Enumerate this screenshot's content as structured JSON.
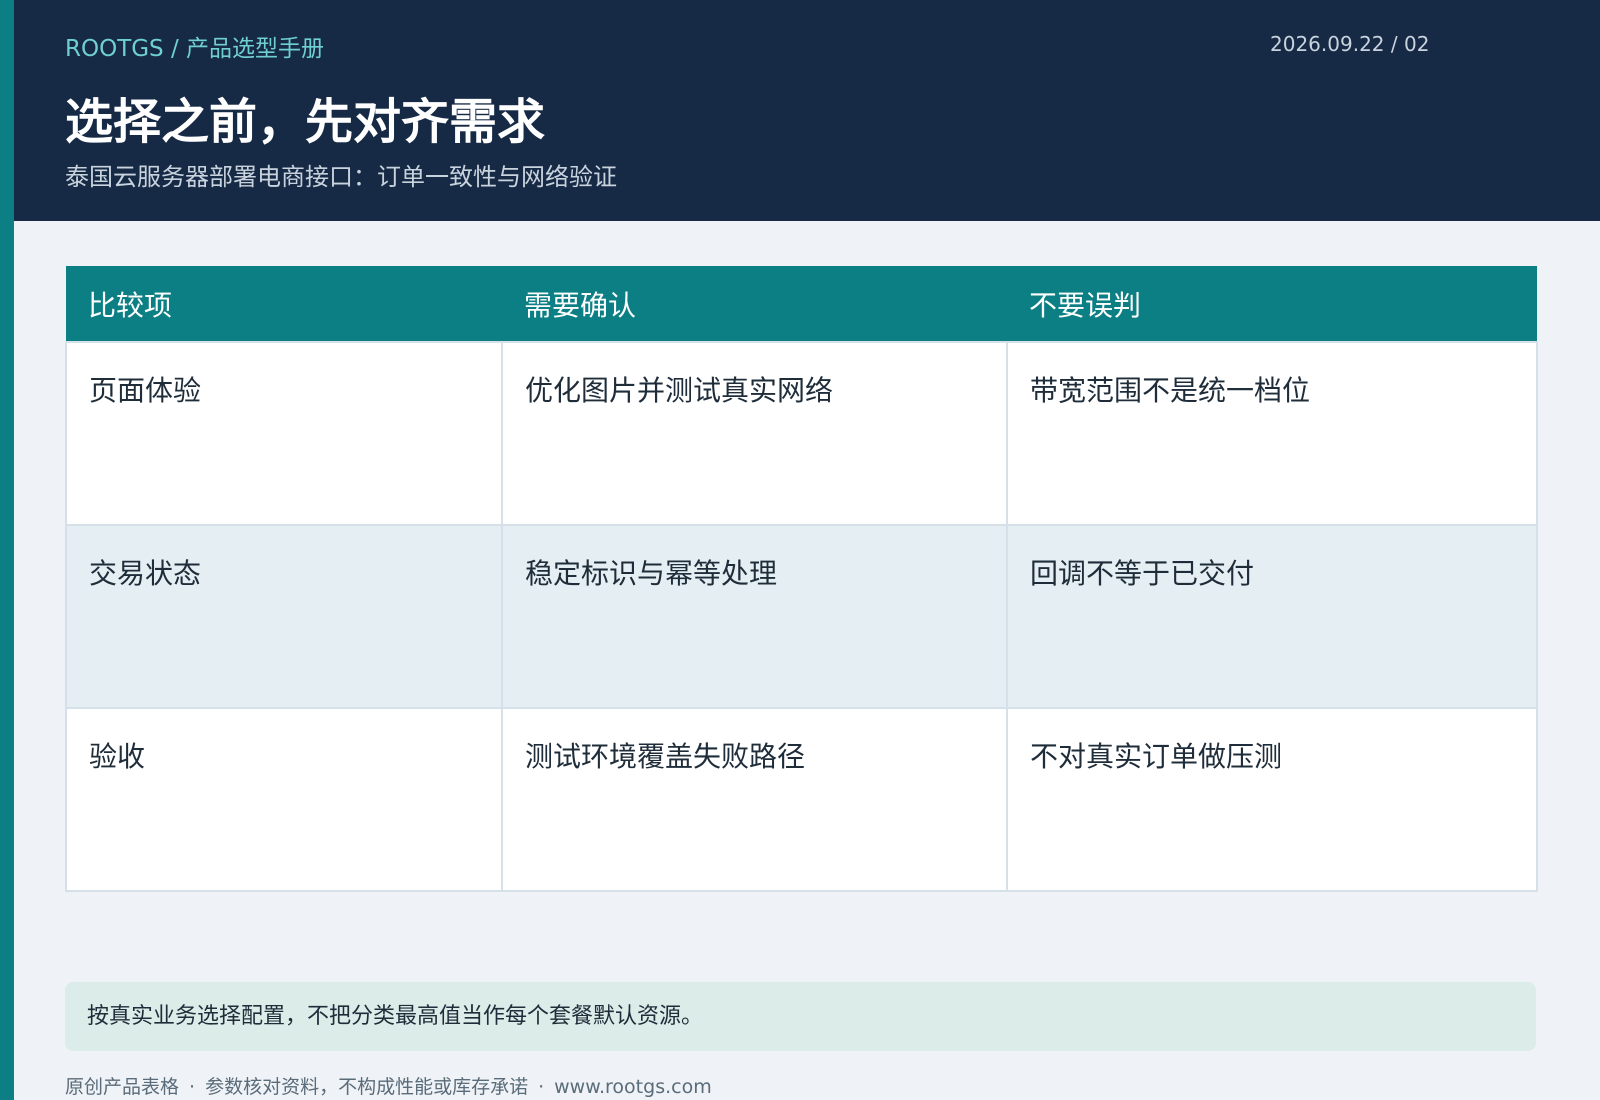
{
  "header": {
    "breadcrumb": "ROOTGS / 产品选型手册",
    "meta": "2026.09.22 / 02",
    "title": "选择之前，先对齐需求",
    "subtitle": "泰国云服务器部署电商接口：订单一致性与网络验证"
  },
  "table": {
    "columns": [
      "比较项",
      "需要确认",
      "不要误判"
    ],
    "rows": [
      [
        "页面体验",
        "优化图片并测试真实网络",
        "带宽范围不是统一档位"
      ],
      [
        "交易状态",
        "稳定标识与幂等处理",
        "回调不等于已交付"
      ],
      [
        "验收",
        "测试环境覆盖失败路径",
        "不对真实订单做压测"
      ]
    ]
  },
  "note": "按真实业务选择配置，不把分类最高值当作每个套餐默认资源。",
  "footer": {
    "items": [
      "原创产品表格",
      "参数核对资料，不构成性能或库存承诺",
      "www.rootgs.com"
    ],
    "separator": "·"
  },
  "colors": {
    "header_bg": "#172a45",
    "accent": "#0b7f84",
    "breadcrumb": "#6fd0cf",
    "note_bg": "#dcece9"
  }
}
